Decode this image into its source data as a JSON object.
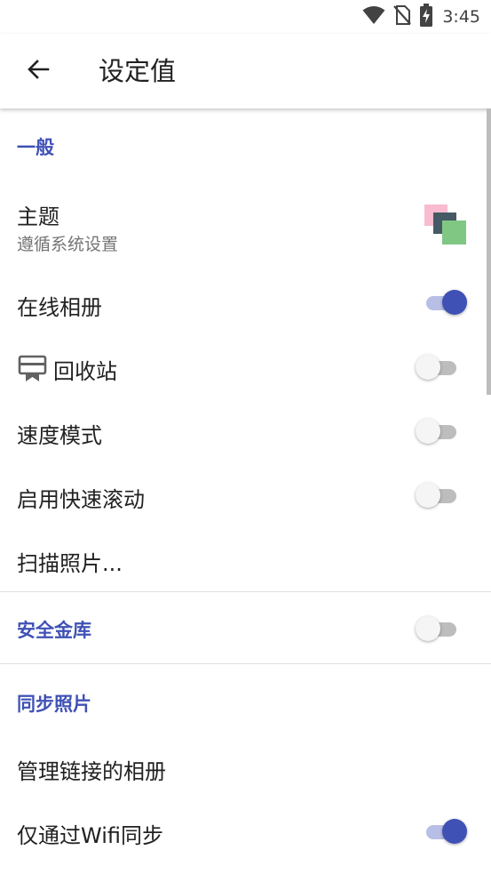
{
  "status_bar": {
    "time": "3:45",
    "icons": [
      "wifi-icon",
      "no-sim-icon",
      "battery-charging-icon"
    ]
  },
  "app_bar": {
    "title": "设定值",
    "back_icon": "arrow-back-icon"
  },
  "colors": {
    "accent": "#3f51b5",
    "switch_on_track": "#b7bfe6",
    "switch_off_track": "#bdbdbd",
    "divider": "#e0e0e0",
    "theme_pink": "#f8bbd0",
    "theme_dark": "#455a64",
    "theme_green": "#81c784"
  },
  "sections": {
    "general": {
      "header": "一般",
      "theme": {
        "title": "主题",
        "summary": "遵循系统设置",
        "icon": "theme-swatch-icon"
      },
      "online_album": {
        "title": "在线相册",
        "enabled": true
      },
      "recycle_bin": {
        "title": "回收站",
        "enabled": false,
        "icon": "recycle-bin-icon"
      },
      "speed_mode": {
        "title": "速度模式",
        "enabled": false
      },
      "fast_scroll": {
        "title": "启用快速滚动",
        "enabled": false
      },
      "scan_photos": {
        "title": "扫描照片..."
      }
    },
    "vault": {
      "header": "安全金库",
      "enabled": false
    },
    "sync": {
      "header": "同步照片",
      "manage_albums": {
        "title": "管理链接的相册"
      },
      "wifi_only": {
        "title": "仅通过Wifi同步",
        "enabled": true
      }
    }
  }
}
